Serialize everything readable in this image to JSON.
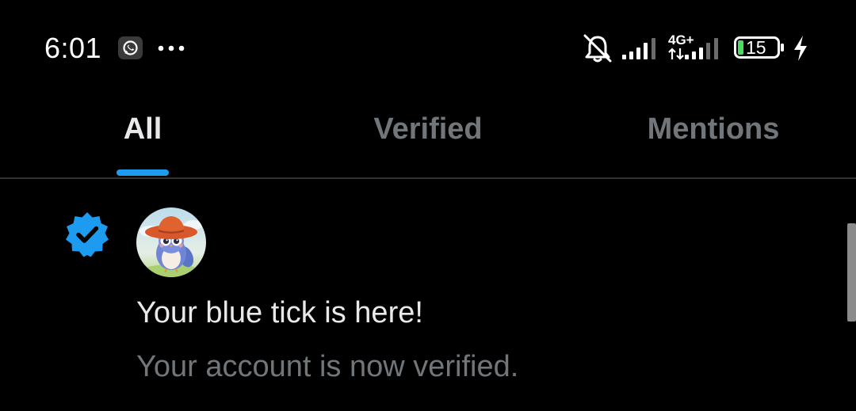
{
  "status_bar": {
    "time": "6:01",
    "network_type": "4G+",
    "battery_level": "15",
    "icons": [
      "whatsapp-icon",
      "more-icon",
      "mute-icon",
      "signal-icon",
      "data-arrows-icon",
      "battery-icon",
      "charging-icon"
    ]
  },
  "tabs": [
    {
      "label": "All",
      "active": true
    },
    {
      "label": "Verified",
      "active": false
    },
    {
      "label": "Mentions",
      "active": false
    }
  ],
  "notification": {
    "icon": "verified-badge-icon",
    "title": "Your blue tick is here!",
    "body": "Your account is now verified."
  },
  "colors": {
    "background": "#000000",
    "accent": "#1d9bf0",
    "text_primary": "#e7e9ea",
    "text_secondary": "#71767b",
    "battery_fill": "#4cd964"
  }
}
